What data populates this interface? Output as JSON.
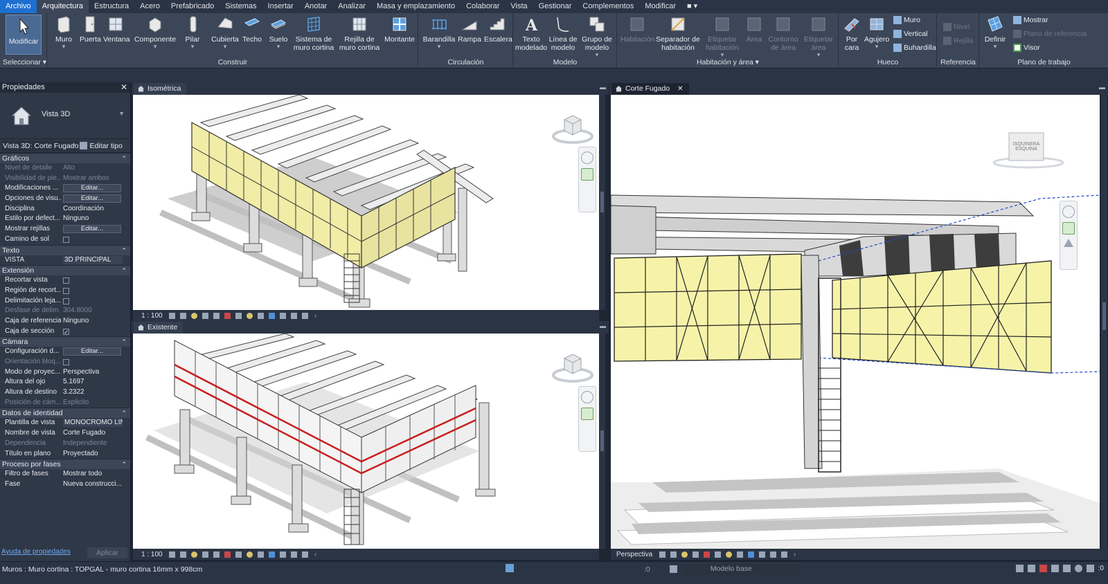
{
  "menu": {
    "tabs": [
      "Archivo",
      "Arquitectura",
      "Estructura",
      "Acero",
      "Prefabricado",
      "Sistemas",
      "Insertar",
      "Anotar",
      "Analizar",
      "Masa y emplazamiento",
      "Colaborar",
      "Vista",
      "Gestionar",
      "Complementos",
      "Modificar"
    ],
    "active_tab": "Arquitectura",
    "extra": "■ ▾"
  },
  "ribbon": {
    "seleccionar": {
      "modify_label": "Modificar",
      "group_label": "Seleccionar ▾"
    },
    "construir": {
      "group_label": "Construir",
      "buttons": [
        "Muro",
        "Puerta",
        "Ventana",
        "Componente",
        "Pilar",
        "Cubierta",
        "Techo",
        "Suelo",
        "Sistema de\nmuro cortina",
        "Rejilla de\nmuro cortina",
        "Montante"
      ]
    },
    "circulacion": {
      "group_label": "Circulación",
      "buttons": [
        "Barandilla",
        "Rampa",
        "Escalera"
      ]
    },
    "modelo": {
      "group_label": "Modelo",
      "buttons": [
        "Texto\nmodelado",
        "Línea de\nmodelo",
        "Grupo de\nmodelo"
      ]
    },
    "habitacion": {
      "group_label": "Habitación y área ▾",
      "buttons": [
        "Habitación",
        "Separador de\nhabitación",
        "Etiquetar\nhabitación",
        "Área",
        "Contorno\nde área",
        "Etiquetar\nárea"
      ]
    },
    "hueco": {
      "group_label": "Hueco",
      "buttons": [
        "Por\ncara",
        "Agujero"
      ],
      "small": [
        "Muro",
        "Vertical",
        "Buhardilla"
      ]
    },
    "referencia": {
      "group_label": "Referencia",
      "small": [
        "Nivel",
        "Rejilla"
      ]
    },
    "plano": {
      "group_label": "Plano de trabajo",
      "define": "Definir",
      "small": [
        "Mostrar",
        "Plano de referencia",
        "Visor"
      ]
    }
  },
  "properties": {
    "title": "Propiedades",
    "type_name": "Vista 3D",
    "instance": "Vista 3D: Corte Fugado",
    "edit_type": "Editar tipo",
    "help": "Ayuda de propiedades",
    "apply": "Aplicar",
    "groups": [
      {
        "name": "Gráficos",
        "rows": [
          {
            "n": "Nivel de detalle",
            "v": "Alto",
            "dim": true
          },
          {
            "n": "Visibilidad de pie...",
            "v": "Mostrar ambos",
            "dim": true
          },
          {
            "n": "Modificaciones ...",
            "v": "Editar...",
            "kind": "button"
          },
          {
            "n": "Opciones de visu...",
            "v": "Editar...",
            "kind": "button"
          },
          {
            "n": "Disciplina",
            "v": "Coordinación"
          },
          {
            "n": "Estilo por defect...",
            "v": "Ninguno"
          },
          {
            "n": "Mostrar rejillas",
            "v": "Editar...",
            "kind": "button"
          },
          {
            "n": "Camino de sol",
            "v": "",
            "kind": "check",
            "checked": false
          }
        ]
      },
      {
        "name": "Texto",
        "rows": [
          {
            "n": "VISTA",
            "v": "3D PRINCIPAL",
            "kind": "field"
          }
        ]
      },
      {
        "name": "Extensión",
        "rows": [
          {
            "n": "Recortar vista",
            "v": "",
            "kind": "check",
            "checked": false
          },
          {
            "n": "Región de recort...",
            "v": "",
            "kind": "check",
            "checked": false
          },
          {
            "n": "Delimitación leja...",
            "v": "",
            "kind": "check",
            "checked": false
          },
          {
            "n": "Desfase de delim...",
            "v": "304.8000",
            "dim": true
          },
          {
            "n": "Caja de referencia",
            "v": "Ninguno"
          },
          {
            "n": "Caja de sección",
            "v": "",
            "kind": "check",
            "checked": true
          }
        ]
      },
      {
        "name": "Cámara",
        "rows": [
          {
            "n": "Configuración d...",
            "v": "Editar...",
            "kind": "button"
          },
          {
            "n": "Orientación bloq...",
            "v": "",
            "kind": "check",
            "checked": false,
            "dim": true
          },
          {
            "n": "Modo de proyec...",
            "v": "Perspectiva"
          },
          {
            "n": "Altura del ojo",
            "v": "5.1697"
          },
          {
            "n": "Altura de destino",
            "v": "3.2322"
          },
          {
            "n": "Posición de cám...",
            "v": "Explicito",
            "dim": true
          }
        ]
      },
      {
        "name": "Datos de identidad",
        "rows": [
          {
            "n": "Plantilla de vista",
            "v": "MONOCROMO LIN",
            "kind": "field"
          },
          {
            "n": "Nombre de vista",
            "v": "Corte Fugado"
          },
          {
            "n": "Dependencia",
            "v": "Independiente",
            "dim": true
          },
          {
            "n": "Título en plano",
            "v": "Proyectado"
          }
        ]
      },
      {
        "name": "Proceso por fases",
        "rows": [
          {
            "n": "Filtro de fases",
            "v": "Mostrar todo"
          },
          {
            "n": "Fase",
            "v": "Nueva construcci..."
          }
        ]
      }
    ]
  },
  "views": {
    "top_left": {
      "tab": "Isométrica",
      "scale": "1 : 100"
    },
    "bottom_left": {
      "tab": "Existente",
      "scale": "1 : 100"
    },
    "right": {
      "tab": "Corte Fugado",
      "scale": "Perspectiva",
      "close": "✕",
      "viewcube_text": "ISQUINERA ESQUINA"
    }
  },
  "status": {
    "text": "Muros : Muro cortina : TOPGAL  - muro cortina 16mm x 998cm",
    "workset": ":0",
    "model": "Modelo base",
    "filter": ":0"
  }
}
